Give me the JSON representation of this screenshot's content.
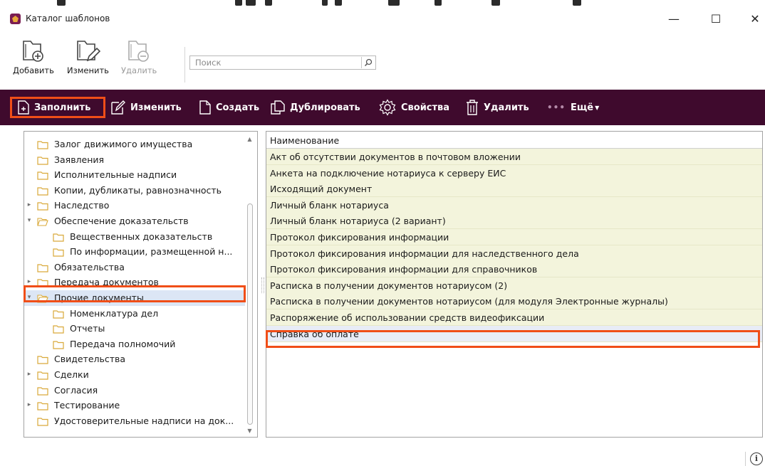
{
  "window": {
    "title": "Каталог шаблонов",
    "controls": {
      "minimize": "—",
      "maximize": "☐",
      "close": "✕"
    }
  },
  "toolbar": {
    "add_label": "Добавить",
    "edit_label": "Изменить",
    "delete_label": "Удалить",
    "search_placeholder": "Поиск"
  },
  "actions": [
    {
      "label": "Заполнить",
      "icon": "fill-document-icon"
    },
    {
      "label": "Изменить",
      "icon": "edit-pencil-icon"
    },
    {
      "label": "Создать",
      "icon": "new-document-icon"
    },
    {
      "label": "Дублировать",
      "icon": "duplicate-icon"
    },
    {
      "label": "Свойства",
      "icon": "gear-icon"
    },
    {
      "label": "Удалить",
      "icon": "trash-icon"
    },
    {
      "label": "Ещё",
      "icon": "more-dots-icon"
    }
  ],
  "tree": [
    {
      "label": "Залог движимого имущества",
      "level": 0,
      "arrow": ""
    },
    {
      "label": "Заявления",
      "level": 0,
      "arrow": ""
    },
    {
      "label": "Исполнительные надписи",
      "level": 0,
      "arrow": ""
    },
    {
      "label": "Копии, дубликаты, равнозначность",
      "level": 0,
      "arrow": ""
    },
    {
      "label": "Наследство",
      "level": 0,
      "arrow": "collapsed"
    },
    {
      "label": "Обеспечение доказательств",
      "level": 0,
      "arrow": "expanded"
    },
    {
      "label": "Вещественных доказательств",
      "level": 1,
      "arrow": ""
    },
    {
      "label": "По информации, размещенной н...",
      "level": 1,
      "arrow": ""
    },
    {
      "label": "Обязательства",
      "level": 0,
      "arrow": ""
    },
    {
      "label": "Передача документов",
      "level": 0,
      "arrow": "collapsed"
    },
    {
      "label": "Прочие документы",
      "level": 0,
      "arrow": "expanded",
      "selected": true
    },
    {
      "label": "Номенклатура дел",
      "level": 1,
      "arrow": ""
    },
    {
      "label": "Отчеты",
      "level": 1,
      "arrow": ""
    },
    {
      "label": "Передача полномочий",
      "level": 1,
      "arrow": ""
    },
    {
      "label": "Свидетельства",
      "level": 0,
      "arrow": ""
    },
    {
      "label": "Сделки",
      "level": 0,
      "arrow": "collapsed"
    },
    {
      "label": "Согласия",
      "level": 0,
      "arrow": ""
    },
    {
      "label": "Тестирование",
      "level": 0,
      "arrow": "collapsed"
    },
    {
      "label": "Удостоверительные надписи на док...",
      "level": 0,
      "arrow": ""
    }
  ],
  "list": {
    "header": "Наименование",
    "rows": [
      "Акт об отсутствии документов в почтовом вложении",
      "Анкета на подключение нотариуса к серверу ЕИС",
      "Исходящий документ",
      "Личный бланк нотариуса",
      "Личный бланк нотариуса (2 вариант)",
      "Протокол фиксирования информации",
      "Протокол фиксирования информации для наследственного дела",
      "Протокол фиксирования информации для справочников",
      "Расписка в получении документов нотариусом (2)",
      "Расписка в получении документов нотариусом (для модуля Электронные журналы)",
      "Распоряжение об использовании средств видеофиксации",
      "Справка об оплате"
    ],
    "selected_index": 11
  },
  "status": {
    "info_glyph": "i"
  },
  "colors": {
    "actionbar": "#3f0a2d",
    "highlight": "#f04e18",
    "row_fill": "#f3f4dc",
    "selected_row": "#e8ecf6",
    "folder": "#e9c46a"
  }
}
